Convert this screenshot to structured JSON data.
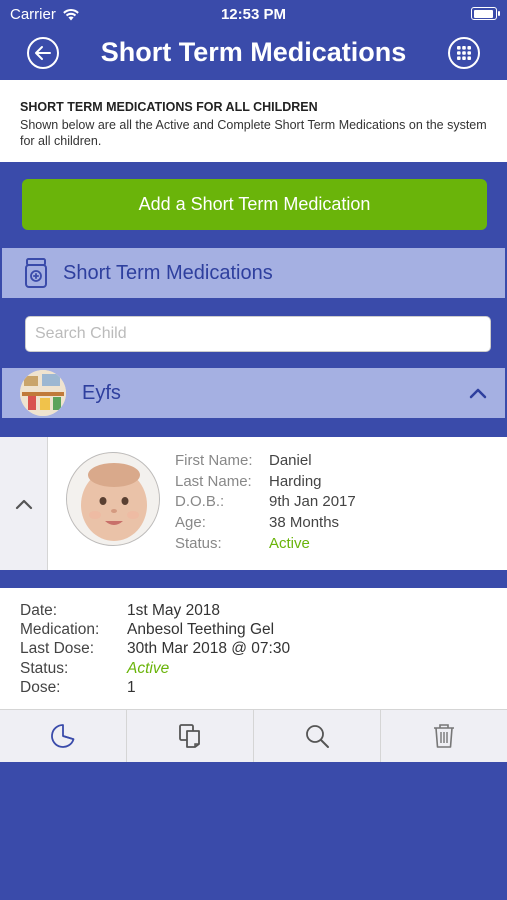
{
  "status_bar": {
    "carrier": "Carrier",
    "time": "12:53 PM",
    "battery_level": 0.95
  },
  "header": {
    "title": "Short Term Medications",
    "back_icon": "back-arrow-circle-icon",
    "menu_icon": "grid-menu-icon"
  },
  "info": {
    "heading": "SHORT TERM MEDICATIONS FOR ALL CHILDREN",
    "text": "Shown below are all the Active and Complete Short Term Medications on the system for all children."
  },
  "add_button": {
    "label": "Add a Short Term Medication"
  },
  "section": {
    "label": "Short Term Medications",
    "icon": "medicine-bottle-icon"
  },
  "search": {
    "placeholder": "Search Child",
    "value": ""
  },
  "group": {
    "label": "Eyfs",
    "icon": "chevron-up-icon"
  },
  "child": {
    "first_name_label": "First Name:",
    "first_name": "Daniel",
    "last_name_label": "Last Name:",
    "last_name": "Harding",
    "dob_label": "D.O.B.:",
    "dob": "9th Jan 2017",
    "age_label": "Age:",
    "age": "38 Months",
    "status_label": "Status:",
    "status": "Active"
  },
  "medication": {
    "date_label": "Date:",
    "date": "1st May 2018",
    "medication_label": "Medication:",
    "medication": "Anbesol Teething Gel",
    "last_dose_label": "Last Dose:",
    "last_dose": "30th Mar 2018 @ 07:30",
    "status_label": "Status:",
    "status": "Active",
    "dose_label": "Dose:",
    "dose": "1"
  },
  "toolbar": {
    "icons": [
      "chart-icon",
      "copy-icon",
      "search-icon",
      "trash-icon"
    ]
  },
  "colors": {
    "primary": "#3A4BAA",
    "accent_green": "#6AB40A",
    "section_bg": "#A5B0E2",
    "section_text": "#2E3F9E"
  }
}
